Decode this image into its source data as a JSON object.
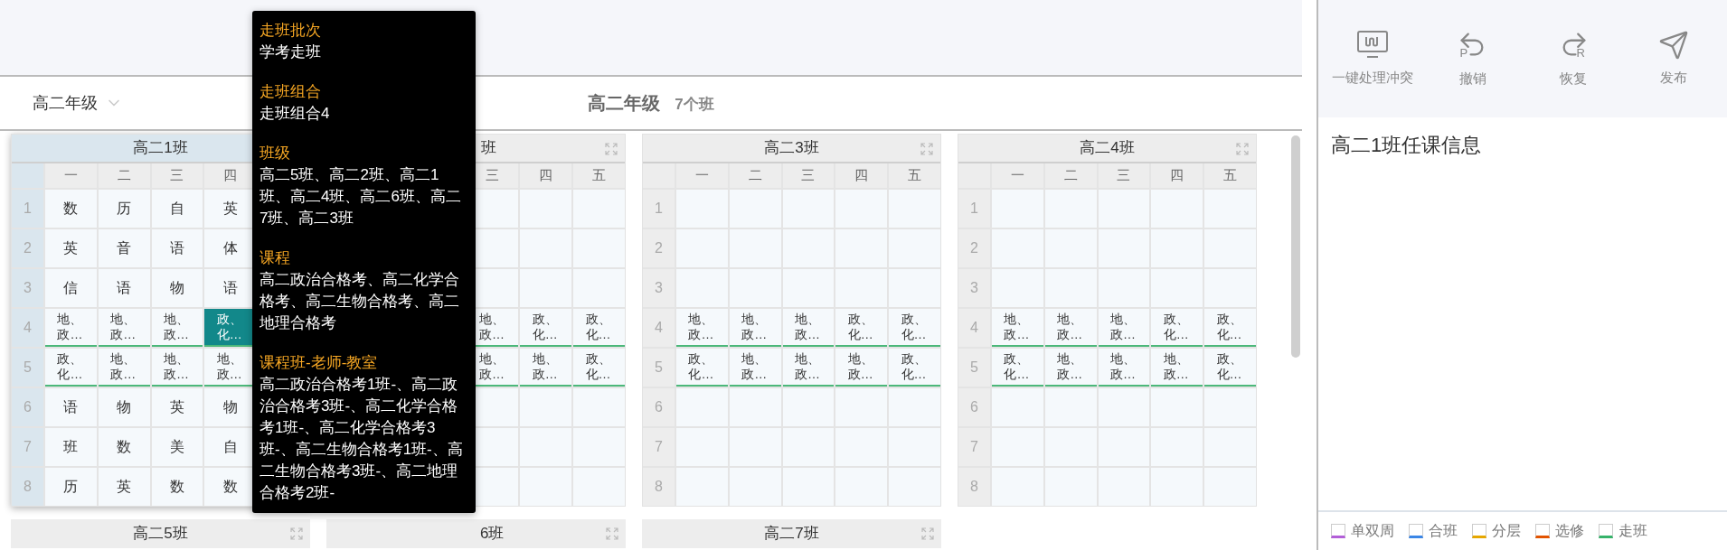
{
  "header": {
    "grade_dropdown": "高二年级",
    "title": "高二年级",
    "class_count": "7个班"
  },
  "cards": [
    {
      "title": "高二1班",
      "selected": true,
      "days": [
        "一",
        "二",
        "三",
        "四"
      ],
      "rows": [
        {
          "number": "1",
          "kind": "normal",
          "cells": [
            {
              "text": "数",
              "selected": false
            },
            {
              "text": "历",
              "selected": false
            },
            {
              "text": "自",
              "selected": false
            },
            {
              "text": "英",
              "selected": false
            }
          ]
        },
        {
          "number": "2",
          "kind": "normal",
          "cells": [
            {
              "text": "英",
              "selected": false
            },
            {
              "text": "音",
              "selected": false
            },
            {
              "text": "语",
              "selected": false
            },
            {
              "text": "体",
              "selected": false
            }
          ]
        },
        {
          "number": "3",
          "kind": "normal",
          "cells": [
            {
              "text": "信",
              "selected": false
            },
            {
              "text": "语",
              "selected": false
            },
            {
              "text": "物",
              "selected": false
            },
            {
              "text": "语",
              "selected": false
            }
          ]
        },
        {
          "number": "4",
          "kind": "walk",
          "cells": [
            {
              "text": "地、政…",
              "selected": false
            },
            {
              "text": "地、政…",
              "selected": false
            },
            {
              "text": "地、政…",
              "selected": false
            },
            {
              "text": "政、化…",
              "selected": true
            }
          ]
        },
        {
          "number": "5",
          "kind": "walk",
          "cells": [
            {
              "text": "政、化…",
              "selected": false
            },
            {
              "text": "地、政…",
              "selected": false
            },
            {
              "text": "地、政…",
              "selected": false
            },
            {
              "text": "地、政…",
              "selected": false
            }
          ]
        },
        {
          "number": "6",
          "kind": "normal",
          "cells": [
            {
              "text": "语",
              "selected": false
            },
            {
              "text": "物",
              "selected": false
            },
            {
              "text": "英",
              "selected": false
            },
            {
              "text": "物",
              "selected": false
            }
          ]
        },
        {
          "number": "7",
          "kind": "normal",
          "cells": [
            {
              "text": "班",
              "selected": false
            },
            {
              "text": "数",
              "selected": false
            },
            {
              "text": "美",
              "selected": false
            },
            {
              "text": "自",
              "selected": false
            }
          ]
        },
        {
          "number": "8",
          "kind": "normal",
          "cells": [
            {
              "text": "历",
              "selected": false
            },
            {
              "text": "英",
              "selected": false
            },
            {
              "text": "数",
              "selected": false
            },
            {
              "text": "数",
              "selected": false
            }
          ]
        }
      ]
    },
    {
      "title": "班",
      "selected": false,
      "days": [
        "三",
        "四",
        "五"
      ],
      "rows": [
        {
          "kind": "normal",
          "cells": [
            {
              "selected": false
            },
            {
              "selected": false
            },
            {
              "selected": false
            }
          ]
        },
        {
          "kind": "normal",
          "cells": [
            {
              "selected": false
            },
            {
              "selected": false
            },
            {
              "selected": false
            }
          ]
        },
        {
          "kind": "normal",
          "cells": [
            {
              "selected": false
            },
            {
              "selected": false
            },
            {
              "selected": false
            }
          ]
        },
        {
          "kind": "walk",
          "cells": [
            {
              "text": "地、政…",
              "selected": false
            },
            {
              "text": "政、化…",
              "selected": false
            },
            {
              "text": "政、化…",
              "selected": false
            }
          ]
        },
        {
          "kind": "walk",
          "cells": [
            {
              "text": "地、政…",
              "selected": false
            },
            {
              "text": "地、政…",
              "selected": false
            },
            {
              "text": "政、化…",
              "selected": false
            }
          ]
        },
        {
          "kind": "normal",
          "cells": [
            {
              "selected": false
            },
            {
              "selected": false
            },
            {
              "selected": false
            }
          ]
        },
        {
          "kind": "normal",
          "cells": [
            {
              "selected": false
            },
            {
              "selected": false
            },
            {
              "selected": false
            }
          ]
        },
        {
          "kind": "normal",
          "cells": [
            {
              "selected": false
            },
            {
              "selected": false
            },
            {
              "selected": false
            }
          ]
        }
      ]
    },
    {
      "title": "高二3班",
      "selected": false,
      "days": [
        "一",
        "二",
        "三",
        "四",
        "五"
      ],
      "rows": [
        {
          "number": "1",
          "kind": "normal",
          "cells": [
            {
              "selected": false
            },
            {
              "selected": false
            },
            {
              "selected": false
            },
            {
              "selected": false
            },
            {
              "selected": false
            }
          ]
        },
        {
          "number": "2",
          "kind": "normal",
          "cells": [
            {
              "selected": false
            },
            {
              "selected": false
            },
            {
              "selected": false
            },
            {
              "selected": false
            },
            {
              "selected": false
            }
          ]
        },
        {
          "number": "3",
          "kind": "normal",
          "cells": [
            {
              "selected": false
            },
            {
              "selected": false
            },
            {
              "selected": false
            },
            {
              "selected": false
            },
            {
              "selected": false
            }
          ]
        },
        {
          "number": "4",
          "kind": "walk",
          "cells": [
            {
              "text": "地、政…",
              "selected": false
            },
            {
              "text": "地、政…",
              "selected": false
            },
            {
              "text": "地、政…",
              "selected": false
            },
            {
              "text": "政、化…",
              "selected": false
            },
            {
              "text": "政、化…",
              "selected": false
            }
          ]
        },
        {
          "number": "5",
          "kind": "walk",
          "cells": [
            {
              "text": "政、化…",
              "selected": false
            },
            {
              "text": "地、政…",
              "selected": false
            },
            {
              "text": "地、政…",
              "selected": false
            },
            {
              "text": "地、政…",
              "selected": false
            },
            {
              "text": "政、化…",
              "selected": false
            }
          ]
        },
        {
          "number": "6",
          "kind": "normal",
          "cells": [
            {
              "selected": false
            },
            {
              "selected": false
            },
            {
              "selected": false
            },
            {
              "selected": false
            },
            {
              "selected": false
            }
          ]
        },
        {
          "number": "7",
          "kind": "normal",
          "cells": [
            {
              "selected": false
            },
            {
              "selected": false
            },
            {
              "selected": false
            },
            {
              "selected": false
            },
            {
              "selected": false
            }
          ]
        },
        {
          "number": "8",
          "kind": "normal",
          "cells": [
            {
              "selected": false
            },
            {
              "selected": false
            },
            {
              "selected": false
            },
            {
              "selected": false
            },
            {
              "selected": false
            }
          ]
        }
      ]
    },
    {
      "title": "高二4班",
      "selected": false,
      "days": [
        "一",
        "二",
        "三",
        "四",
        "五"
      ],
      "rows": [
        {
          "number": "1",
          "kind": "normal",
          "cells": [
            {
              "selected": false
            },
            {
              "selected": false
            },
            {
              "selected": false
            },
            {
              "selected": false
            },
            {
              "selected": false
            }
          ]
        },
        {
          "number": "2",
          "kind": "normal",
          "cells": [
            {
              "selected": false
            },
            {
              "selected": false
            },
            {
              "selected": false
            },
            {
              "selected": false
            },
            {
              "selected": false
            }
          ]
        },
        {
          "number": "3",
          "kind": "normal",
          "cells": [
            {
              "selected": false
            },
            {
              "selected": false
            },
            {
              "selected": false
            },
            {
              "selected": false
            },
            {
              "selected": false
            }
          ]
        },
        {
          "number": "4",
          "kind": "walk",
          "cells": [
            {
              "text": "地、政…",
              "selected": false
            },
            {
              "text": "地、政…",
              "selected": false
            },
            {
              "text": "地、政…",
              "selected": false
            },
            {
              "text": "政、化…",
              "selected": false
            },
            {
              "text": "政、化…",
              "selected": false
            }
          ]
        },
        {
          "number": "5",
          "kind": "walk",
          "cells": [
            {
              "text": "政、化…",
              "selected": false
            },
            {
              "text": "地、政…",
              "selected": false
            },
            {
              "text": "地、政…",
              "selected": false
            },
            {
              "text": "地、政…",
              "selected": false
            },
            {
              "text": "政、化…",
              "selected": false
            }
          ]
        },
        {
          "number": "6",
          "kind": "normal",
          "cells": [
            {
              "selected": false
            },
            {
              "selected": false
            },
            {
              "selected": false
            },
            {
              "selected": false
            },
            {
              "selected": false
            }
          ]
        },
        {
          "number": "7",
          "kind": "normal",
          "cells": [
            {
              "selected": false
            },
            {
              "selected": false
            },
            {
              "selected": false
            },
            {
              "selected": false
            },
            {
              "selected": false
            }
          ]
        },
        {
          "number": "8",
          "kind": "normal",
          "cells": [
            {
              "selected": false
            },
            {
              "selected": false
            },
            {
              "selected": false
            },
            {
              "selected": false
            },
            {
              "selected": false
            }
          ]
        }
      ]
    }
  ],
  "more_cards": [
    {
      "title": "高二5班"
    },
    {
      "title": "6班"
    },
    {
      "title": "高二7班"
    }
  ],
  "tooltip": [
    {
      "label": "走班批次",
      "value": "学考走班"
    },
    {
      "label": "走班组合",
      "value": "走班组合4"
    },
    {
      "label": "班级",
      "value": "高二5班、高二2班、高二1班、高二4班、高二6班、高二7班、高二3班"
    },
    {
      "label": "课程",
      "value": "高二政治合格考、高二化学合格考、高二生物合格考、高二地理合格考"
    },
    {
      "label": "课程班-老师-教室",
      "value": "高二政治合格考1班-、高二政治合格考3班-、高二化学合格考1班-、高二化学合格考3班-、高二生物合格考1班-、高二生物合格考3班-、高二地理合格考2班-"
    }
  ],
  "toolbar": [
    {
      "kind": "resolve",
      "label": "一键处理冲突"
    },
    {
      "kind": "undo",
      "label": "撤销",
      "icon_letter": "P"
    },
    {
      "kind": "redo",
      "label": "恢复",
      "icon_letter": "R"
    },
    {
      "kind": "publish",
      "label": "发布"
    }
  ],
  "panel_title": "高二1班任课信息",
  "legend": [
    {
      "label": "单双周",
      "color": "#b35fd8"
    },
    {
      "label": "合班",
      "color": "#3b86e6"
    },
    {
      "label": "分层",
      "color": "#e6a700"
    },
    {
      "label": "选修",
      "color": "#e25300"
    },
    {
      "label": "走班",
      "color": "#36b36a"
    }
  ]
}
